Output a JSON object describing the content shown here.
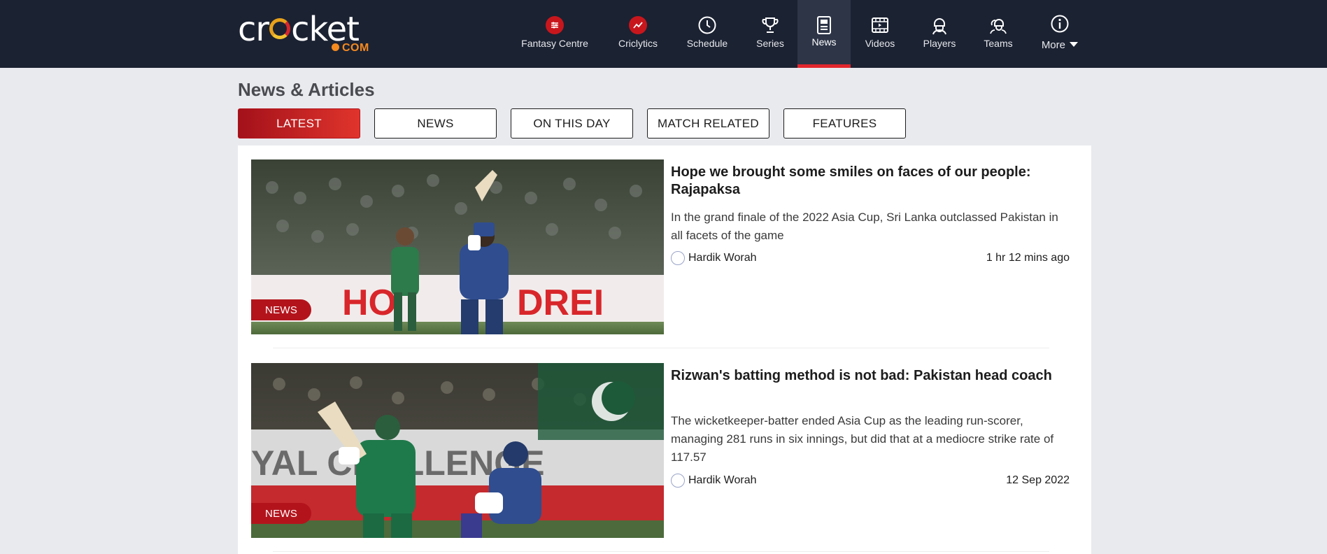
{
  "brand": {
    "name_part1": "cr",
    "name_part2": "cket",
    "suffix": "COM"
  },
  "nav": [
    {
      "label": "Fantasy Centre",
      "icon": "fantasy-icon"
    },
    {
      "label": "Criclytics",
      "icon": "criclytics-icon"
    },
    {
      "label": "Schedule",
      "icon": "clock-icon"
    },
    {
      "label": "Series",
      "icon": "trophy-icon"
    },
    {
      "label": "News",
      "icon": "newspaper-icon",
      "active": true
    },
    {
      "label": "Videos",
      "icon": "video-icon"
    },
    {
      "label": "Players",
      "icon": "player-icon"
    },
    {
      "label": "Teams",
      "icon": "team-icon"
    },
    {
      "label": "More",
      "icon": "info-icon"
    }
  ],
  "page": {
    "title": "News & Articles"
  },
  "tabs": [
    {
      "label": "LATEST",
      "active": true
    },
    {
      "label": "NEWS"
    },
    {
      "label": "ON THIS DAY"
    },
    {
      "label": "MATCH RELATED"
    },
    {
      "label": "FEATURES"
    }
  ],
  "articles": [
    {
      "badge": "NEWS",
      "title": "Hope we brought some smiles on faces of our people: Rajapaksa",
      "description": "In the grand finale of the 2022 Asia Cup, Sri Lanka outclassed Pakistan in all facets of the game",
      "author": "Hardik Worah",
      "time": "1 hr 12 mins ago"
    },
    {
      "badge": "NEWS",
      "title": "Rizwan's batting method is not bad: Pakistan head coach",
      "description": "The wicketkeeper-batter ended Asia Cup as the leading run-scorer, managing 281 runs in six innings, but did that at a mediocre strike rate of 117.57",
      "author": "Hardik Worah",
      "time": "12 Sep 2022"
    }
  ],
  "colors": {
    "header_bg": "#1b2232",
    "accent": "#e2262d",
    "brand_orange": "#f58a1f"
  }
}
